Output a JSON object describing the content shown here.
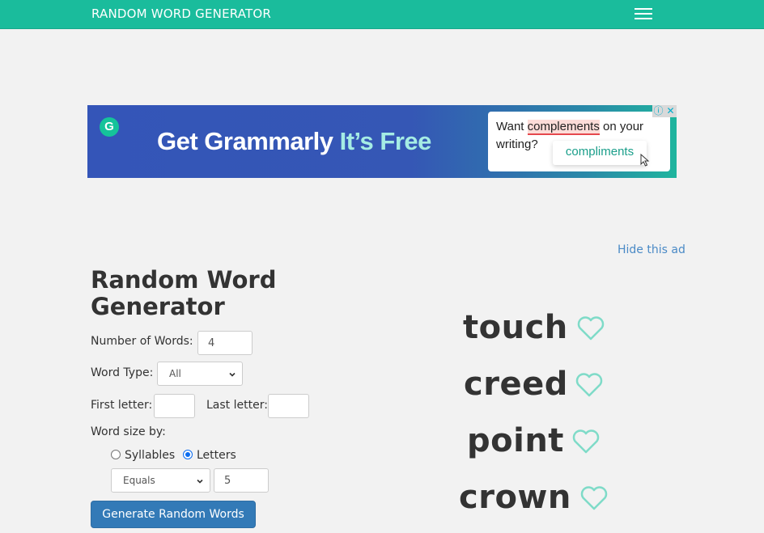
{
  "navbar": {
    "brand": "RANDOM WORD GENERATOR",
    "menu_icon": "hamburger-icon",
    "color": "#1abc9c"
  },
  "ad": {
    "logo_letter": "G",
    "headline": "Get Grammarly",
    "headline_accent": "It’s Free",
    "card_text_before": "Want",
    "card_misspelled": "complements",
    "card_text_after": "on your writing?",
    "suggestion": "compliments",
    "info_icon": "ⓘ",
    "close_icon": "✕",
    "hide_label": "Hide this ad"
  },
  "form": {
    "title": "Random Word Generator",
    "number_of_words_label": "Number of Words:",
    "number_of_words_value": "4",
    "word_type_label": "Word Type:",
    "word_type_selected": "All",
    "first_letter_label": "First letter:",
    "first_letter_value": "",
    "last_letter_label": "Last letter:",
    "last_letter_value": "",
    "word_size_label": "Word size by:",
    "size_options": [
      {
        "label": "Syllables",
        "checked": false
      },
      {
        "label": "Letters",
        "checked": true
      }
    ],
    "size_comparison_selected": "Equals",
    "size_value": "5",
    "generate_label": "Generate Random Words",
    "button_color": "#337ab7"
  },
  "results": {
    "heart_color": "#7fdbc8",
    "words": [
      "touch",
      "creed",
      "point",
      "crown"
    ]
  }
}
